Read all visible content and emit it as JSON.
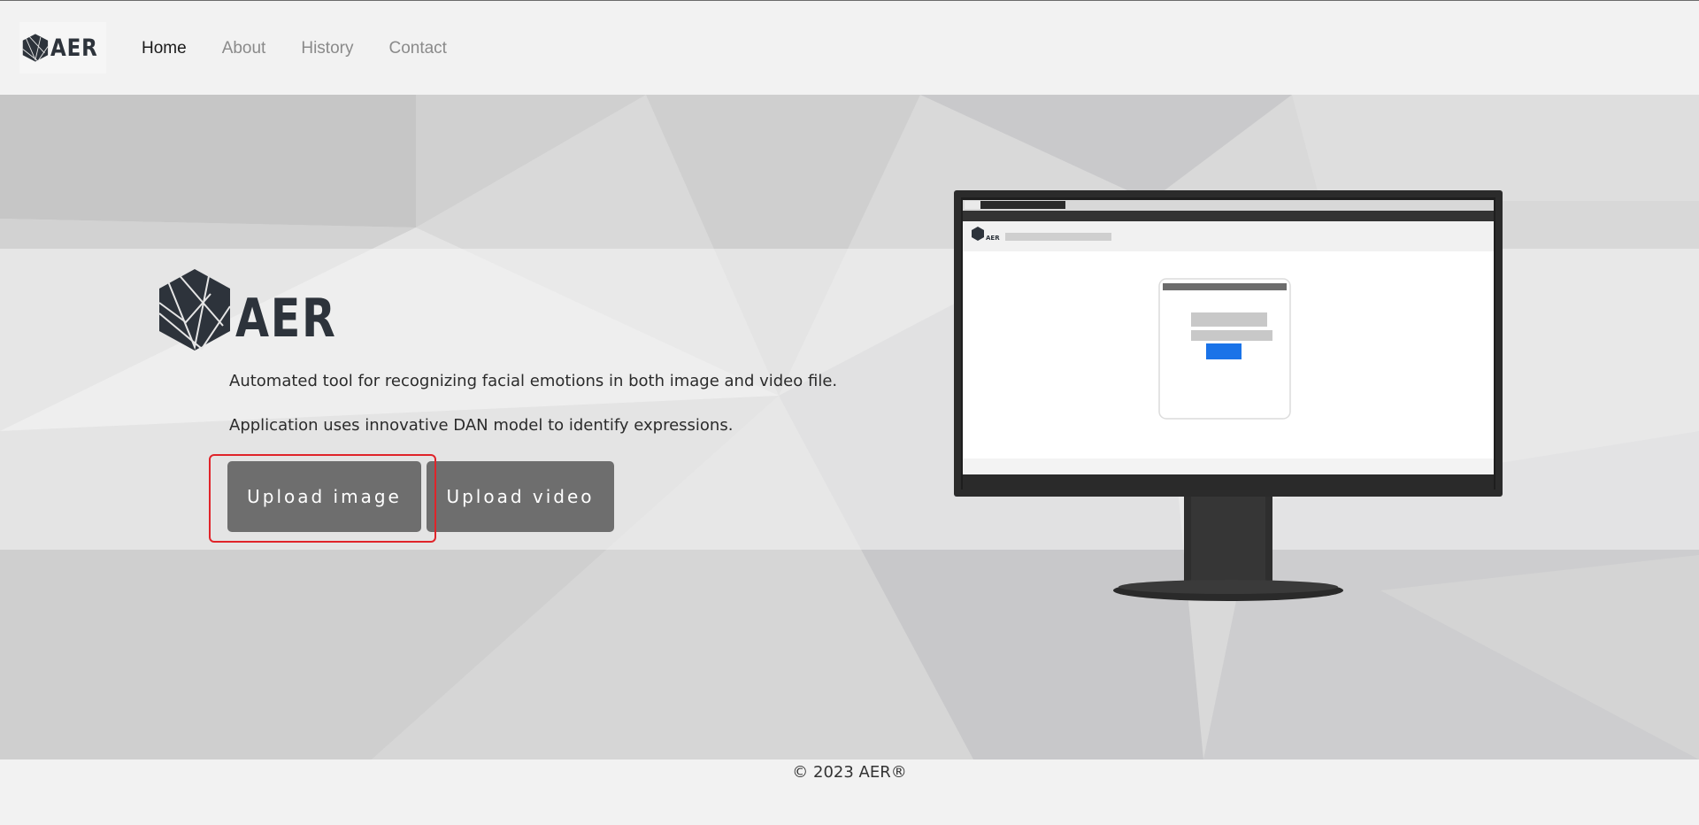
{
  "brand": {
    "name": "AER"
  },
  "nav": {
    "items": [
      {
        "label": "Home",
        "active": true
      },
      {
        "label": "About",
        "active": false
      },
      {
        "label": "History",
        "active": false
      },
      {
        "label": "Contact",
        "active": false
      }
    ]
  },
  "hero": {
    "logo_text": "AER",
    "description_line1": "Automated tool for recognizing facial emotions in both image and video file.",
    "description_line2": "Application uses innovative DAN model to identify expressions.",
    "buttons": {
      "upload_image_label": "Upload image",
      "upload_video_label": "Upload video"
    },
    "monitor_preview": {
      "brand_text": "AER"
    }
  },
  "footer": {
    "copyright": "© 2023 AER®"
  },
  "colors": {
    "button_bg": "#6e6e6e",
    "highlight": "#e0242a",
    "logo": "#2d333b",
    "preview_button": "#1a73e8"
  }
}
